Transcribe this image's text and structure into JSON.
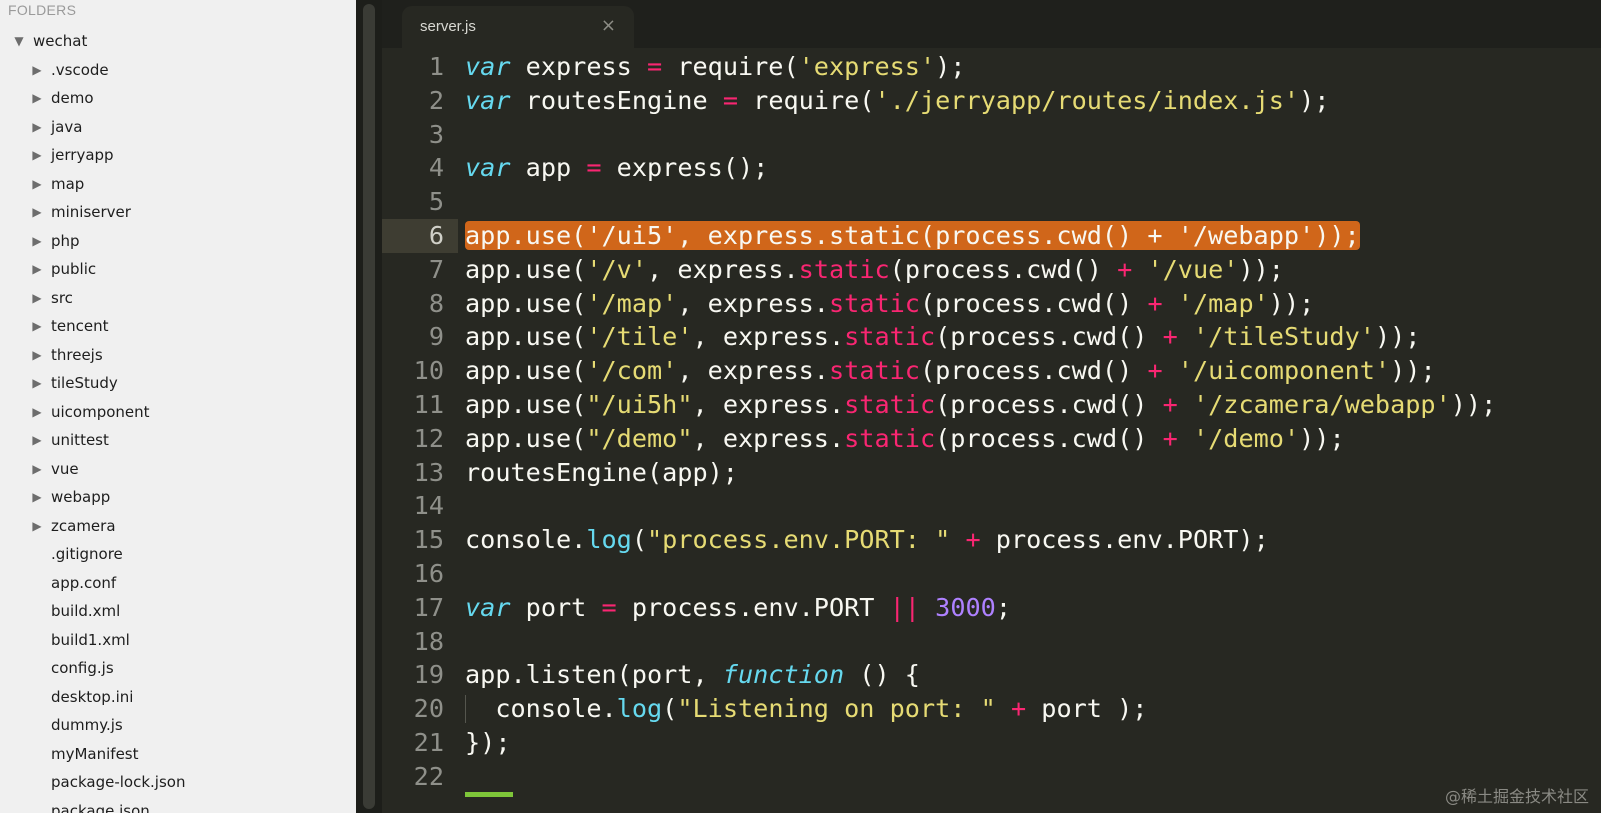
{
  "sidebar": {
    "header": "FOLDERS",
    "tree": [
      {
        "label": "wechat",
        "kind": "root"
      },
      {
        "label": ".vscode",
        "kind": "folder"
      },
      {
        "label": "demo",
        "kind": "folder"
      },
      {
        "label": "java",
        "kind": "folder"
      },
      {
        "label": "jerryapp",
        "kind": "folder"
      },
      {
        "label": "map",
        "kind": "folder"
      },
      {
        "label": "miniserver",
        "kind": "folder"
      },
      {
        "label": "php",
        "kind": "folder"
      },
      {
        "label": "public",
        "kind": "folder"
      },
      {
        "label": "src",
        "kind": "folder"
      },
      {
        "label": "tencent",
        "kind": "folder"
      },
      {
        "label": "threejs",
        "kind": "folder"
      },
      {
        "label": "tileStudy",
        "kind": "folder"
      },
      {
        "label": "uicomponent",
        "kind": "folder"
      },
      {
        "label": "unittest",
        "kind": "folder"
      },
      {
        "label": "vue",
        "kind": "folder"
      },
      {
        "label": "webapp",
        "kind": "folder"
      },
      {
        "label": "zcamera",
        "kind": "folder"
      },
      {
        "label": ".gitignore",
        "kind": "file"
      },
      {
        "label": "app.conf",
        "kind": "file"
      },
      {
        "label": "build.xml",
        "kind": "file"
      },
      {
        "label": "build1.xml",
        "kind": "file"
      },
      {
        "label": "config.js",
        "kind": "file"
      },
      {
        "label": "desktop.ini",
        "kind": "file"
      },
      {
        "label": "dummy.js",
        "kind": "file"
      },
      {
        "label": "myManifest",
        "kind": "file"
      },
      {
        "label": "package-lock.json",
        "kind": "file"
      },
      {
        "label": "package.json",
        "kind": "file"
      }
    ]
  },
  "tab": {
    "label": "server.js",
    "close_glyph": "×"
  },
  "editor": {
    "current_line": 6,
    "colors": {
      "keyword": "#66d9ef",
      "operator": "#f92672",
      "string": "#e6db74",
      "number": "#ae81ff",
      "selection": "#d0661a"
    },
    "lines": [
      [
        [
          "kw",
          "var"
        ],
        [
          "t",
          " express "
        ],
        [
          "op",
          "="
        ],
        [
          "t",
          " require("
        ],
        [
          "str",
          "'express'"
        ],
        [
          "t",
          ");"
        ]
      ],
      [
        [
          "kw",
          "var"
        ],
        [
          "t",
          " routesEngine "
        ],
        [
          "op",
          "="
        ],
        [
          "t",
          " require("
        ],
        [
          "str",
          "'./jerryapp/routes/index.js'"
        ],
        [
          "t",
          ");"
        ]
      ],
      [],
      [
        [
          "kw",
          "var"
        ],
        [
          "t",
          " app "
        ],
        [
          "op",
          "="
        ],
        [
          "t",
          " express();"
        ]
      ],
      [],
      [
        [
          "sel",
          "app.use('/ui5', express.static(process.cwd() + '/webapp'));"
        ]
      ],
      [
        [
          "t",
          "app.use("
        ],
        [
          "str",
          "'/v'"
        ],
        [
          "t",
          ", express."
        ],
        [
          "op",
          "static"
        ],
        [
          "t",
          "(process.cwd() "
        ],
        [
          "op",
          "+"
        ],
        [
          "t",
          " "
        ],
        [
          "str",
          "'/vue'"
        ],
        [
          "t",
          "));"
        ]
      ],
      [
        [
          "t",
          "app.use("
        ],
        [
          "str",
          "'/map'"
        ],
        [
          "t",
          ", express."
        ],
        [
          "op",
          "static"
        ],
        [
          "t",
          "(process.cwd() "
        ],
        [
          "op",
          "+"
        ],
        [
          "t",
          " "
        ],
        [
          "str",
          "'/map'"
        ],
        [
          "t",
          "));"
        ]
      ],
      [
        [
          "t",
          "app.use("
        ],
        [
          "str",
          "'/tile'"
        ],
        [
          "t",
          ", express."
        ],
        [
          "op",
          "static"
        ],
        [
          "t",
          "(process.cwd() "
        ],
        [
          "op",
          "+"
        ],
        [
          "t",
          " "
        ],
        [
          "str",
          "'/tileStudy'"
        ],
        [
          "t",
          "));"
        ]
      ],
      [
        [
          "t",
          "app.use("
        ],
        [
          "str",
          "'/com'"
        ],
        [
          "t",
          ", express."
        ],
        [
          "op",
          "static"
        ],
        [
          "t",
          "(process.cwd() "
        ],
        [
          "op",
          "+"
        ],
        [
          "t",
          " "
        ],
        [
          "str",
          "'/uicomponent'"
        ],
        [
          "t",
          "));"
        ]
      ],
      [
        [
          "t",
          "app.use("
        ],
        [
          "str",
          "\"/ui5h\""
        ],
        [
          "t",
          ", express."
        ],
        [
          "op",
          "static"
        ],
        [
          "t",
          "(process.cwd() "
        ],
        [
          "op",
          "+"
        ],
        [
          "t",
          " "
        ],
        [
          "str",
          "'/zcamera/webapp'"
        ],
        [
          "t",
          "));"
        ]
      ],
      [
        [
          "t",
          "app.use("
        ],
        [
          "str",
          "\"/demo\""
        ],
        [
          "t",
          ", express."
        ],
        [
          "op",
          "static"
        ],
        [
          "t",
          "(process.cwd() "
        ],
        [
          "op",
          "+"
        ],
        [
          "t",
          " "
        ],
        [
          "str",
          "'/demo'"
        ],
        [
          "t",
          "));"
        ]
      ],
      [
        [
          "t",
          "routesEngine(app);"
        ]
      ],
      [],
      [
        [
          "t",
          "console."
        ],
        [
          "fn",
          "log"
        ],
        [
          "t",
          "("
        ],
        [
          "str",
          "\"process.env.PORT: \""
        ],
        [
          "t",
          " "
        ],
        [
          "op",
          "+"
        ],
        [
          "t",
          " process.env.PORT);"
        ]
      ],
      [],
      [
        [
          "kw",
          "var"
        ],
        [
          "t",
          " port "
        ],
        [
          "op",
          "="
        ],
        [
          "t",
          " process.env.PORT "
        ],
        [
          "op",
          "||"
        ],
        [
          "t",
          " "
        ],
        [
          "num",
          "3000"
        ],
        [
          "t",
          ";"
        ]
      ],
      [],
      [
        [
          "t",
          "app.listen(port, "
        ],
        [
          "kw",
          "function"
        ],
        [
          "t",
          " () {"
        ]
      ],
      [
        [
          "t",
          "  console."
        ],
        [
          "fn",
          "log"
        ],
        [
          "t",
          "("
        ],
        [
          "str",
          "\"Listening on port: \""
        ],
        [
          "t",
          " "
        ],
        [
          "op",
          "+"
        ],
        [
          "t",
          " port );"
        ]
      ],
      [
        [
          "t",
          "});"
        ]
      ],
      []
    ]
  },
  "watermark": "@稀土掘金技术社区"
}
